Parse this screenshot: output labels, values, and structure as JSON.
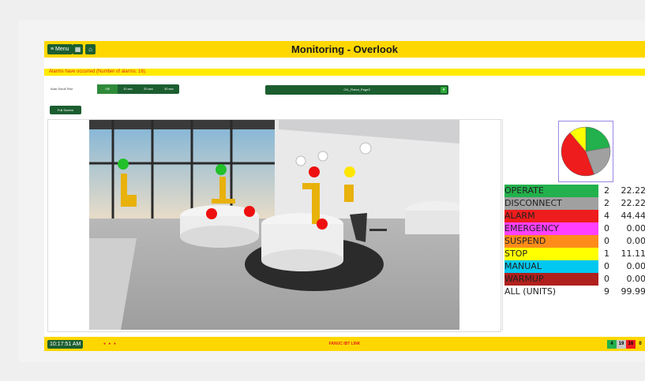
{
  "header": {
    "menu_label": "≡ Menu",
    "title": "Monitoring - Overlook"
  },
  "alarm_banner": "Alarms have occurred (Number of alarms: 16).",
  "controls": {
    "auto_scroll_label": "Auto Scroll Test",
    "intervals": [
      "Off",
      "10 sec",
      "20 sec",
      "30 sec"
    ],
    "selected_interval": "Off",
    "page_selected": "OIL_Robot_Page3",
    "full_screen_label": "Full Screen"
  },
  "status_colors": {
    "OPERATE": "#22b14c",
    "DISCONNECT": "#a0a0a0",
    "ALARM": "#ee1c1c",
    "EMERGENCY": "#ff40ff",
    "SUSPEND": "#ff8c1a",
    "STOP": "#ffff00",
    "MANUAL": "#00c8f0",
    "WARMUP": "#b0201c",
    "ALL (UNITS)": "#ffffff"
  },
  "status_table": [
    {
      "name": "OPERATE",
      "count": "2",
      "percent": "22.22"
    },
    {
      "name": "DISCONNECT",
      "count": "2",
      "percent": "22.22"
    },
    {
      "name": "ALARM",
      "count": "4",
      "percent": "44.44"
    },
    {
      "name": "EMERGENCY",
      "count": "0",
      "percent": "0.00"
    },
    {
      "name": "SUSPEND",
      "count": "0",
      "percent": "0.00"
    },
    {
      "name": "STOP",
      "count": "1",
      "percent": "11.11"
    },
    {
      "name": "MANUAL",
      "count": "0",
      "percent": "0.00"
    },
    {
      "name": "WARMUP",
      "count": "0",
      "percent": "0.00"
    },
    {
      "name": "ALL (UNITS)",
      "count": "9",
      "percent": "99.99"
    }
  ],
  "footer": {
    "time": "10:17:51 AM",
    "brand": "FANUC IBT LINK",
    "counts": [
      {
        "value": "4",
        "bg": "#22b14c"
      },
      {
        "value": "19",
        "bg": "#c8c8c8"
      },
      {
        "value": "16",
        "bg": "#ee1c1c"
      },
      {
        "value": "0",
        "bg": "#ffd700"
      }
    ]
  },
  "scene": {
    "status_lights": [
      "green",
      "green",
      "red",
      "yellow",
      "red",
      "red",
      "red"
    ]
  }
}
